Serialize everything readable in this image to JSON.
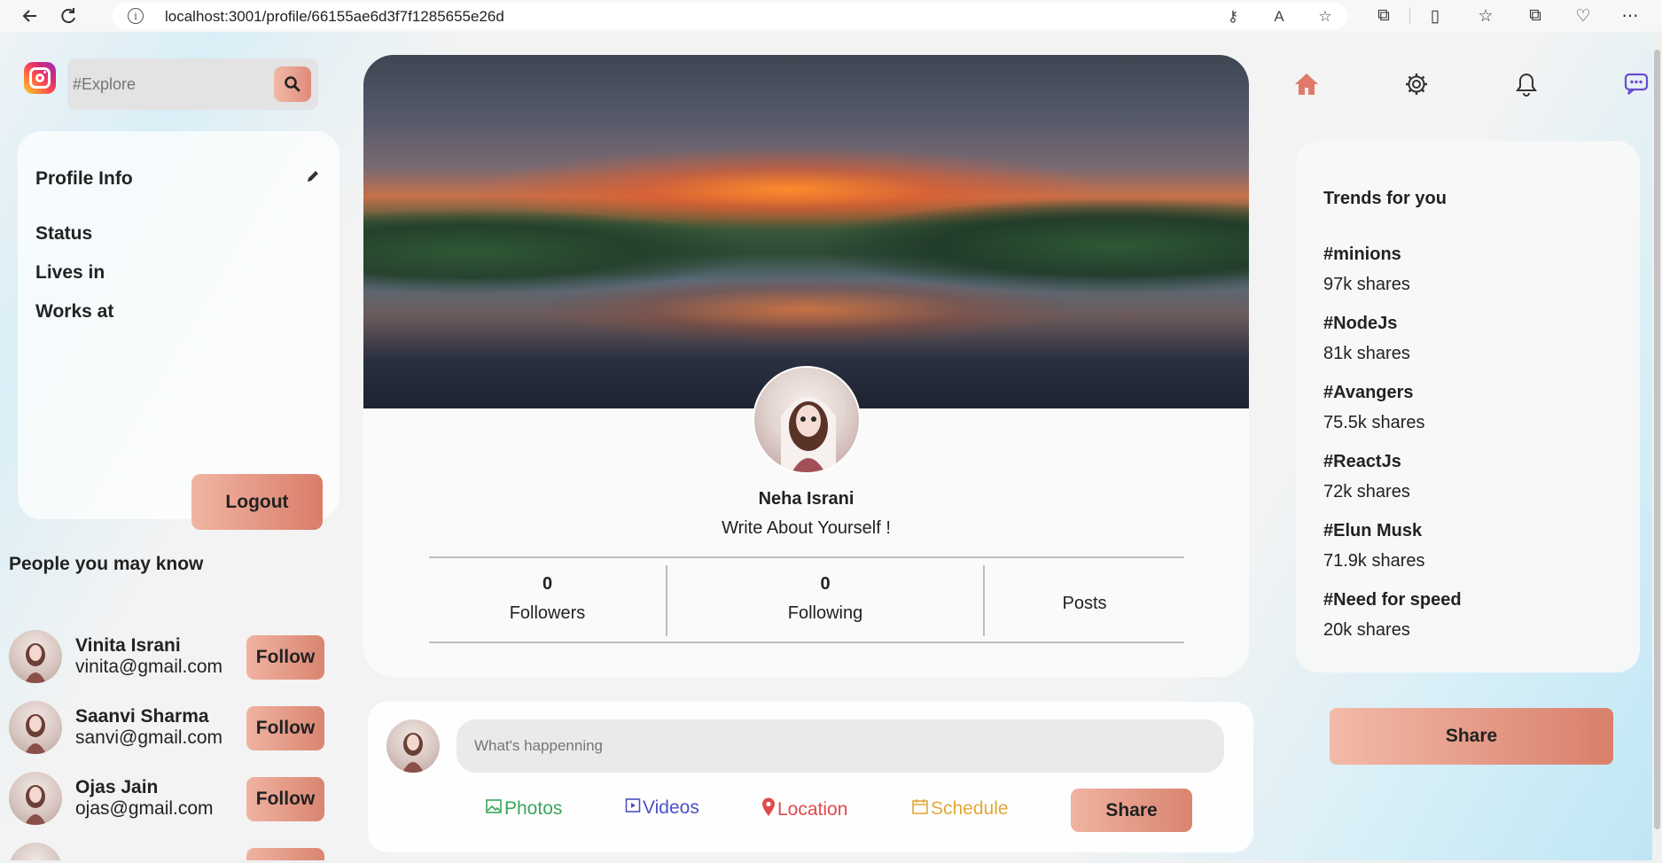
{
  "browser": {
    "url": "localhost:3001/profile/66155ae6d3f7f1285655e26d",
    "back_icon": "arrow-left-icon",
    "reload_icon": "reload-icon"
  },
  "search": {
    "placeholder": "#Explore",
    "icon": "search-icon"
  },
  "profile_info": {
    "title": "Profile Info",
    "rows": [
      "Status",
      "Lives in",
      "Works at"
    ],
    "logout_label": "Logout"
  },
  "people": {
    "title": "People you may know",
    "items": [
      {
        "name": "Vinita Israni",
        "email": "vinita@gmail.com",
        "button": "Follow"
      },
      {
        "name": "Saanvi Sharma",
        "email": "sanvi@gmail.com",
        "button": "Follow"
      },
      {
        "name": "Ojas Jain",
        "email": "ojas@gmail.com",
        "button": "Follow"
      },
      {
        "name": "",
        "email": "",
        "button": ""
      }
    ]
  },
  "profile": {
    "name": "Neha Israni",
    "bio": "Write About Yourself !",
    "followers_count": "0",
    "followers_label": "Followers",
    "following_count": "0",
    "following_label": "Following",
    "posts_label": "Posts"
  },
  "composer": {
    "placeholder": "What's happenning",
    "photos": "Photos",
    "videos": "Videos",
    "location": "Location",
    "schedule": "Schedule",
    "share": "Share"
  },
  "trends": {
    "title": "Trends for you",
    "items": [
      {
        "tag": "#minions",
        "shares": "97k shares"
      },
      {
        "tag": "#NodeJs",
        "shares": "81k shares"
      },
      {
        "tag": "#Avangers",
        "shares": "75.5k shares"
      },
      {
        "tag": "#ReactJs",
        "shares": "72k shares"
      },
      {
        "tag": "#Elun Musk",
        "shares": "71.9k shares"
      },
      {
        "tag": "#Need for speed",
        "shares": "20k shares"
      }
    ],
    "share_label": "Share"
  },
  "colors": {
    "accent": "#e08a79",
    "photos": "#3aa55c",
    "videos": "#4b4fbf",
    "location": "#e04b4b",
    "schedule": "#e0a83a"
  }
}
